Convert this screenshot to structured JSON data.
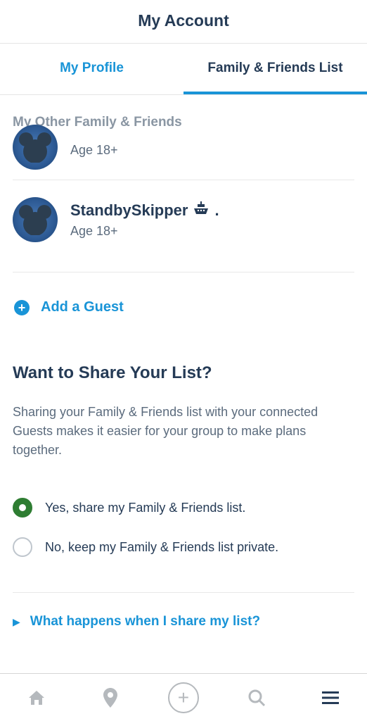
{
  "header": {
    "title": "My Account"
  },
  "tabs": {
    "profile": "My Profile",
    "friends": "Family & Friends List"
  },
  "section_header": "My Other Family & Friends",
  "guests": [
    {
      "name": "",
      "age": "Age 18+"
    },
    {
      "name": "StandbySkipper",
      "age": "Age 18+",
      "suffix": "."
    }
  ],
  "add_guest": "Add a Guest",
  "share": {
    "title": "Want to Share Your List?",
    "description": "Sharing your Family & Friends list with your connected Guests makes it easier for your group to make plans together.",
    "option_yes": "Yes, share my Family & Friends list.",
    "option_no": "No, keep my Family & Friends list private."
  },
  "disclosure": {
    "text": "What happens when I share my list?"
  }
}
